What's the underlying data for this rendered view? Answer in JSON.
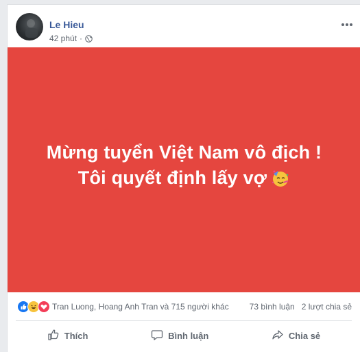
{
  "post": {
    "author": "Le Hieu",
    "time": "42 phút",
    "separator": "·",
    "privacy_icon": "globe-icon",
    "menu_icon": "more-options-icon",
    "banner": {
      "line1": "Mừng tuyển Việt Nam vô địch !",
      "line2": "Tôi quyết định lấy vợ",
      "emoji": "party-face-emoji",
      "background": "#e5463f"
    },
    "reactions": {
      "icons": [
        "like-icon",
        "haha-icon",
        "love-icon"
      ],
      "summary": "Tran Luong, Hoang Anh Tran và 715 người khác",
      "comments": "73 bình luận",
      "shares": "2 lượt chia sẻ"
    },
    "actions": {
      "like": "Thích",
      "comment": "Bình luận",
      "share": "Chia sẻ"
    }
  }
}
